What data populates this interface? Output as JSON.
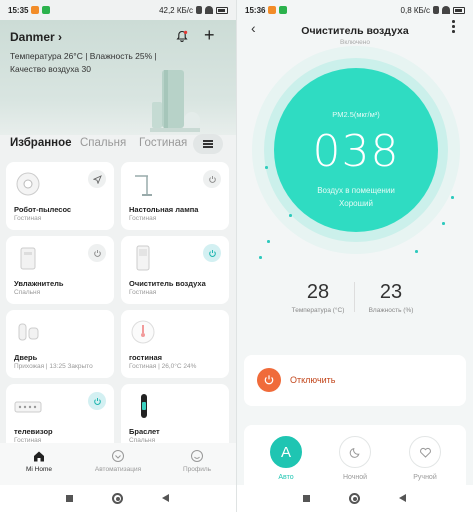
{
  "left": {
    "status": {
      "time": "15:35",
      "net_speed": "42,2 КБ/с"
    },
    "header": {
      "home_name": "Danmer",
      "info_line1": "Температура 26°C | Влажность 25% |",
      "info_line2": "Качество воздуха 30"
    },
    "tabs": [
      "Избранное",
      "Спальня",
      "Гостиная"
    ],
    "devices": [
      {
        "name": "Робот-пылесос",
        "room": "Гостиная",
        "icon": "robot-vacuum-icon",
        "control": "send-icon",
        "on": false
      },
      {
        "name": "Настольная лампа",
        "room": "Гостиная",
        "icon": "desk-lamp-icon",
        "control": "power-icon",
        "on": false
      },
      {
        "name": "Увлажнитель",
        "room": "Спальня",
        "icon": "humidifier-icon",
        "control": "power-icon",
        "on": false
      },
      {
        "name": "Очиститель воздуха",
        "room": "Гостиная",
        "icon": "air-purifier-icon",
        "control": "power-icon",
        "on": true
      },
      {
        "name": "Дверь",
        "room": "Прихожая | 13:25 Закрыто",
        "icon": "door-sensor-icon",
        "control": "",
        "on": false
      },
      {
        "name": "гостиная",
        "room": "Гостиная | 26,0°C 24%",
        "icon": "thermometer-icon",
        "control": "",
        "on": false
      },
      {
        "name": "телевизор",
        "room": "Гостиная",
        "icon": "tv-remote-icon",
        "control": "power-icon",
        "on": true
      },
      {
        "name": "Браслет",
        "room": "Спальня",
        "icon": "fitness-band-icon",
        "control": "",
        "on": false
      }
    ],
    "nav": [
      {
        "label": "Mi Home",
        "icon": "home-icon"
      },
      {
        "label": "Автоматизация",
        "icon": "automation-icon"
      },
      {
        "label": "Профиль",
        "icon": "profile-icon"
      }
    ]
  },
  "right": {
    "status": {
      "time": "15:36",
      "net_speed": "0,8 КБ/с"
    },
    "title": "Очиститель воздуха",
    "subtitle": "Включено",
    "pm_label": "PM2.5(мкг/м³)",
    "pm_value": "038",
    "air_label_1": "Воздух в помещении",
    "air_label_2": "Хороший",
    "temperature": {
      "value": "28",
      "label": "Температура (°C)"
    },
    "humidity": {
      "value": "23",
      "label": "Влажность (%)"
    },
    "power_label": "Отключить",
    "modes": [
      {
        "label": "Авто",
        "glyph": "A",
        "active": true
      },
      {
        "label": "Ночной",
        "glyph": "moon-icon",
        "active": false
      },
      {
        "label": "Ручной",
        "glyph": "heart-icon",
        "active": false
      }
    ]
  },
  "colors": {
    "accent": "#2fdcc2",
    "power_off": "#f06b3a",
    "active_mode": "#1fc5b2"
  }
}
